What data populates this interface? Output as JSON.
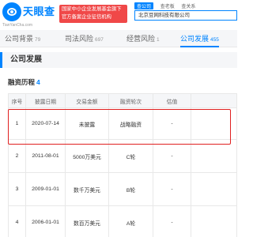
{
  "header": {
    "brand_name": "天眼查",
    "brand_url": "TianYanCha.com",
    "slogan_line1": "国家中小企业发展基金旗下",
    "slogan_line2": "官方备案企业征信机构",
    "search_tabs": [
      "查公司",
      "查老板",
      "查关系"
    ],
    "search_value": "北京豆网科技有限公司"
  },
  "nav": {
    "tabs": [
      {
        "label": "公司背景",
        "count": "79"
      },
      {
        "label": "司法风险",
        "count": "697"
      },
      {
        "label": "经营风险",
        "count": "1"
      },
      {
        "label": "公司发展",
        "count": "455"
      }
    ]
  },
  "section": {
    "title": "公司发展",
    "subtitle": "融资历程",
    "subtitle_count": "4"
  },
  "table": {
    "headers": [
      "序号",
      "披露日期",
      "交易金额",
      "融资轮次",
      "估值",
      ""
    ],
    "rows": [
      {
        "seq": "1",
        "date": "2020-07-14",
        "amount": "未披露",
        "round": "战略融资",
        "valuation": "-"
      },
      {
        "seq": "2",
        "date": "2011-08-01",
        "amount": "5000万美元",
        "round": "C轮",
        "valuation": "-"
      },
      {
        "seq": "3",
        "date": "2009-01-01",
        "amount": "数千万美元",
        "round": "B轮",
        "valuation": "-"
      },
      {
        "seq": "4",
        "date": "2006-01-01",
        "amount": "数百万美元",
        "round": "A轮",
        "valuation": "-"
      }
    ]
  },
  "colors": {
    "accent": "#0084ff",
    "highlight": "#e02020",
    "slogan_bg": "#f04848"
  }
}
